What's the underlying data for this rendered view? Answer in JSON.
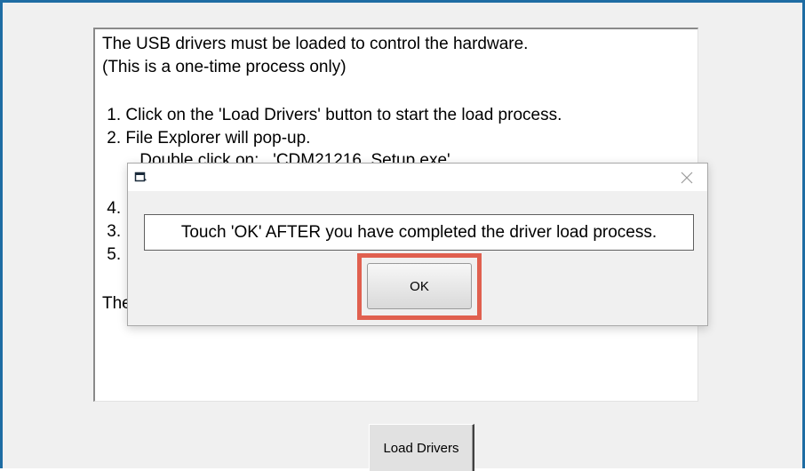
{
  "instructions": {
    "lines": [
      "The USB drivers must be loaded to control the hardware.",
      "(This is a one-time process only)",
      " 1. Click on the 'Load Drivers' button to start the load process.",
      " 2. File Explorer will pop-up.",
      "        Double click on:   'CDM21216_Setup.exe'",
      " 4.",
      " 3.",
      " 5.",
      "The"
    ]
  },
  "load_drivers_button": {
    "label": "Load Drivers"
  },
  "dialog": {
    "title": "",
    "icon": "app-window-icon",
    "close_icon": "close-icon",
    "message": "Touch 'OK' AFTER you have completed the driver load process.",
    "ok_label": "OK",
    "highlight_color": "#e0604f"
  },
  "colors": {
    "frame_border": "#1e6ca3",
    "window_bg": "#f0f0f0"
  }
}
